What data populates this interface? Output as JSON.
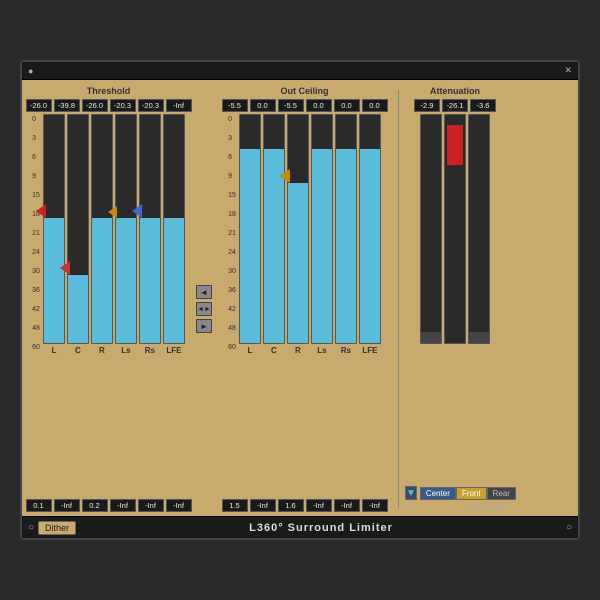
{
  "plugin": {
    "title": "L360° Surround Limiter",
    "bottom_title": "L360° Surround Limiter"
  },
  "threshold": {
    "label": "Threshold",
    "values": [
      "-26.0",
      "-39.8",
      "-26.0",
      "-20.3",
      "-20.3",
      "-Inf"
    ],
    "bottom_values": [
      "0.1",
      "-Inf",
      "0.2",
      "-Inf",
      "-Inf",
      "-Inf"
    ],
    "channel_labels": [
      "L",
      "C",
      "R",
      "Ls",
      "Rs",
      "LFE"
    ],
    "faders": [
      {
        "fill_pct": 55,
        "thumb_pct": 55,
        "color": "#5abcd8",
        "arrow": "left",
        "arrow_color": "#cc2222"
      },
      {
        "fill_pct": 30,
        "thumb_pct": 70,
        "color": "#5abcd8",
        "arrow": "left",
        "arrow_color": "#cc3333"
      },
      {
        "fill_pct": 55,
        "thumb_pct": 55,
        "color": "#5abcd8",
        "arrow": "none",
        "arrow_color": ""
      },
      {
        "fill_pct": 55,
        "thumb_pct": 55,
        "color": "#5abcd8",
        "arrow": "none",
        "arrow_color": ""
      },
      {
        "fill_pct": 55,
        "thumb_pct": 55,
        "color": "#5abcd8",
        "arrow": "left",
        "arrow_color": "#4466cc"
      },
      {
        "fill_pct": 55,
        "thumb_pct": 55,
        "color": "#5abcd8",
        "arrow": "none",
        "arrow_color": ""
      }
    ]
  },
  "outceiling": {
    "label": "Out Ceiling",
    "values": [
      "-5.5",
      "0.0",
      "-5.5",
      "0.0",
      "0.0",
      "0.0"
    ],
    "bottom_values": [
      "1.5",
      "-Inf",
      "1.6",
      "-Inf",
      "-Inf",
      "-Inf"
    ],
    "channel_labels": [
      "L",
      "C",
      "R",
      "Ls",
      "Rs",
      "LFE"
    ],
    "faders": [
      {
        "fill_pct": 85,
        "thumb_pct": 15,
        "color": "#5abcd8",
        "arrow": "none",
        "arrow_color": ""
      },
      {
        "fill_pct": 85,
        "thumb_pct": 15,
        "color": "#5abcd8",
        "arrow": "none",
        "arrow_color": ""
      },
      {
        "fill_pct": 72,
        "thumb_pct": 28,
        "color": "#5abcd8",
        "arrow": "left",
        "arrow_color": "#cc8800"
      },
      {
        "fill_pct": 85,
        "thumb_pct": 15,
        "color": "#5abcd8",
        "arrow": "none",
        "arrow_color": ""
      },
      {
        "fill_pct": 85,
        "thumb_pct": 15,
        "color": "#5abcd8",
        "arrow": "none",
        "arrow_color": ""
      },
      {
        "fill_pct": 85,
        "thumb_pct": 15,
        "color": "#5abcd8",
        "arrow": "none",
        "arrow_color": ""
      }
    ]
  },
  "attenuation": {
    "label": "Attenuation",
    "values": [
      "-2.9",
      "-26.1",
      "-3.6"
    ],
    "faders": [
      {
        "fill_pct": 5,
        "color": "#2a2a2a"
      },
      {
        "fill_pct": 60,
        "color": "#cc2222",
        "has_red": true
      },
      {
        "fill_pct": 5,
        "color": "#2a2a2a"
      }
    ]
  },
  "link_mode": {
    "label": "Link mode",
    "tabs": [
      "Center",
      "Front",
      "Rear"
    ]
  },
  "scale_labels": [
    "0",
    "3",
    "6",
    "9",
    "15",
    "18",
    "21",
    "24",
    "30",
    "36",
    "42",
    "48",
    "60"
  ],
  "dither": {
    "label": "Dither"
  },
  "middle_arrows": {
    "up": "◄",
    "down": "►",
    "both": "◄►"
  }
}
